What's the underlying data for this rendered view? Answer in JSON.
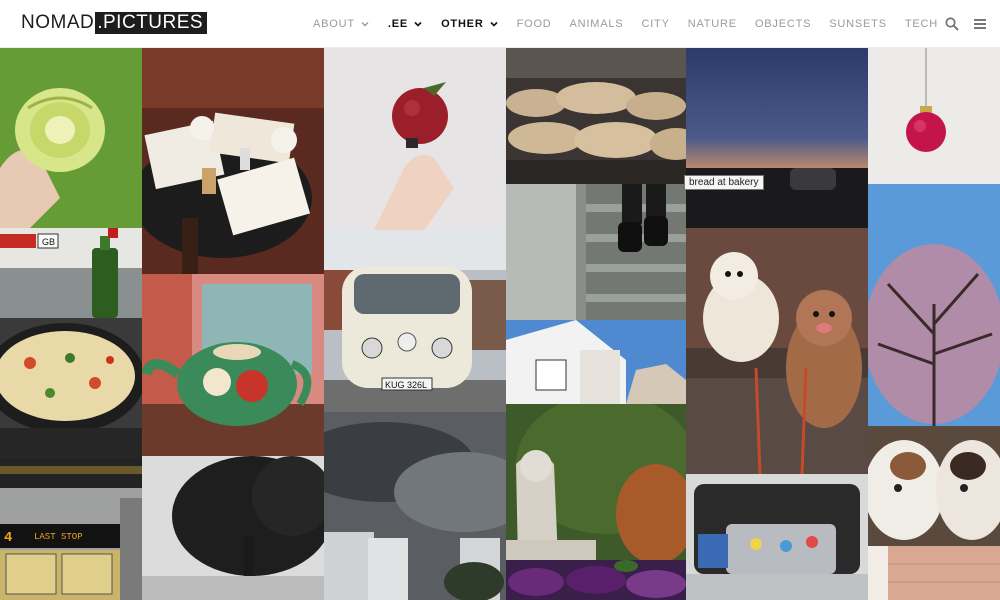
{
  "brand": {
    "part1": "NOMAD",
    "part2": ".PICTURES"
  },
  "nav": {
    "about": "ABOUT",
    "ee": ".EE",
    "other": "OTHER",
    "food": "FOOD",
    "animals": "ANIMALS",
    "city": "CITY",
    "nature": "NATURE",
    "objects": "OBJECTS",
    "sunsets": "SUNSETS",
    "tech": "TECH"
  },
  "tools": {
    "search_icon": "search-icon",
    "menu_icon": "hamburger-menu-icon"
  },
  "tooltip": {
    "text": "bread at bakery"
  },
  "photos": {
    "van_plate": "KUG 326L",
    "train_sign": "LAST STOP",
    "train_number": "4",
    "car_badge": "GB"
  }
}
